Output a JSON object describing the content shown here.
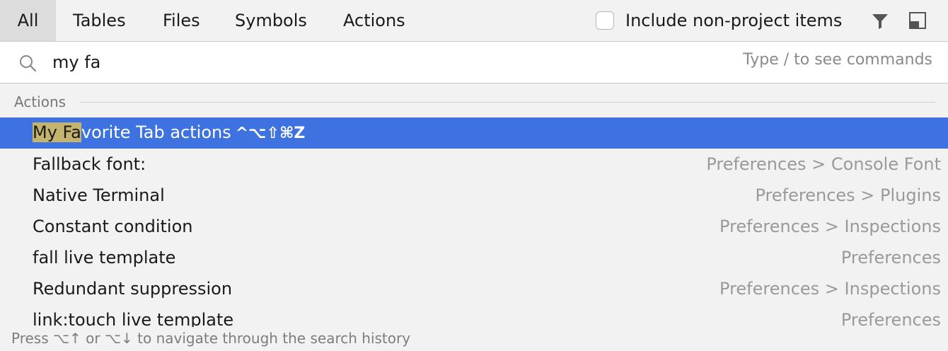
{
  "tabs": [
    {
      "label": "All",
      "active": true
    },
    {
      "label": "Tables",
      "active": false
    },
    {
      "label": "Files",
      "active": false
    },
    {
      "label": "Symbols",
      "active": false
    },
    {
      "label": "Actions",
      "active": false
    }
  ],
  "options": {
    "include_label": "Include non-project items",
    "include_checked": false,
    "filter_icon": "filter-funnel-icon",
    "preview_icon": "preview-panel-icon"
  },
  "search": {
    "icon": "search-icon",
    "value": "my fa",
    "hint": "Type / to see commands"
  },
  "section": {
    "label": "Actions"
  },
  "results": [
    {
      "highlight": "My Fa",
      "rest": "vorite Tab actions",
      "shortcut": "^⌥⇧⌘Z",
      "location": "",
      "selected": true
    },
    {
      "title": "Fallback font:",
      "location": "Preferences > Console Font"
    },
    {
      "title": "Native Terminal",
      "location": "Preferences > Plugins"
    },
    {
      "title": "Constant condition",
      "location": "Preferences > Inspections"
    },
    {
      "title": "fall live template",
      "location": "Preferences"
    },
    {
      "title": "Redundant suppression",
      "location": "Preferences > Inspections"
    },
    {
      "title": "link:touch live template",
      "location": "Preferences"
    }
  ],
  "footer": {
    "text": "Press ⌥↑ or ⌥↓ to navigate through the search history"
  },
  "colors": {
    "selection": "#3d72e0",
    "match_highlight": "#c5b46e",
    "active_tab": "#dcdcdc"
  }
}
